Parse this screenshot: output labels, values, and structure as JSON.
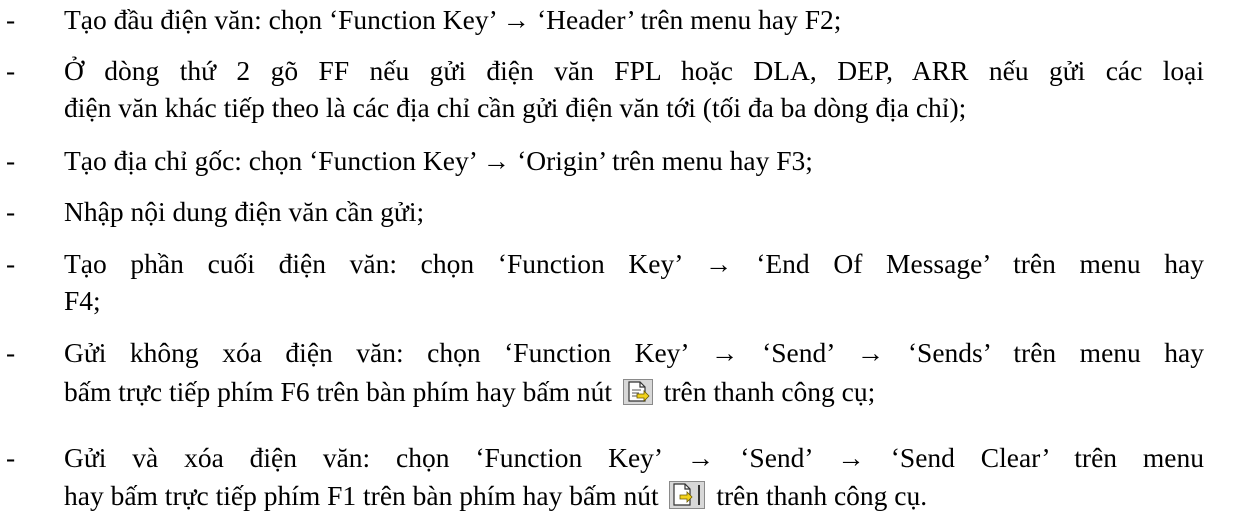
{
  "items": [
    {
      "dash": "-",
      "lines": [
        "Tạo đầu điện văn: chọn ‘Function Key’ → ‘Header’ trên menu hay F2;"
      ]
    },
    {
      "dash": "-",
      "lines": [
        "Ở dòng thứ 2 gõ FF nếu gửi điện văn FPL hoặc DLA, DEP, ARR nếu gửi các loại",
        "điện văn khác tiếp theo là các địa chỉ cần gửi điện văn tới (tối đa ba dòng địa chỉ);"
      ]
    },
    {
      "dash": "-",
      "lines": [
        "Tạo địa chỉ gốc: chọn ‘Function Key’ → ‘Origin’ trên menu hay F3;"
      ]
    },
    {
      "dash": "-",
      "lines": [
        "Nhập nội dung điện văn cần gửi;"
      ]
    },
    {
      "dash": "-",
      "lines": [
        "Tạo phần cuối điện văn: chọn ‘Function Key’ → ‘End Of Message’ trên menu hay",
        "F4;"
      ]
    },
    {
      "dash": "-",
      "lines": [
        "Gửi không xóa điện văn: chọn ‘Function Key’ → ‘Send’ → ‘Sends’ trên menu hay"
      ],
      "line2_before": "bấm trực tiếp phím F6 trên bàn phím hay bấm nút",
      "line2_after": "trên thanh công cụ;",
      "icon": "send-keep-icon"
    },
    {
      "dash": "-",
      "lines": [
        "Gửi và xóa điện văn: chọn ‘Function Key’ → ‘Send’ → ‘Send Clear’ trên menu"
      ],
      "line2_before": "hay bấm trực tiếp phím F1 trên bàn phím hay bấm nút",
      "line2_after": "trên thanh công cụ.",
      "icon": "send-clear-icon"
    }
  ]
}
